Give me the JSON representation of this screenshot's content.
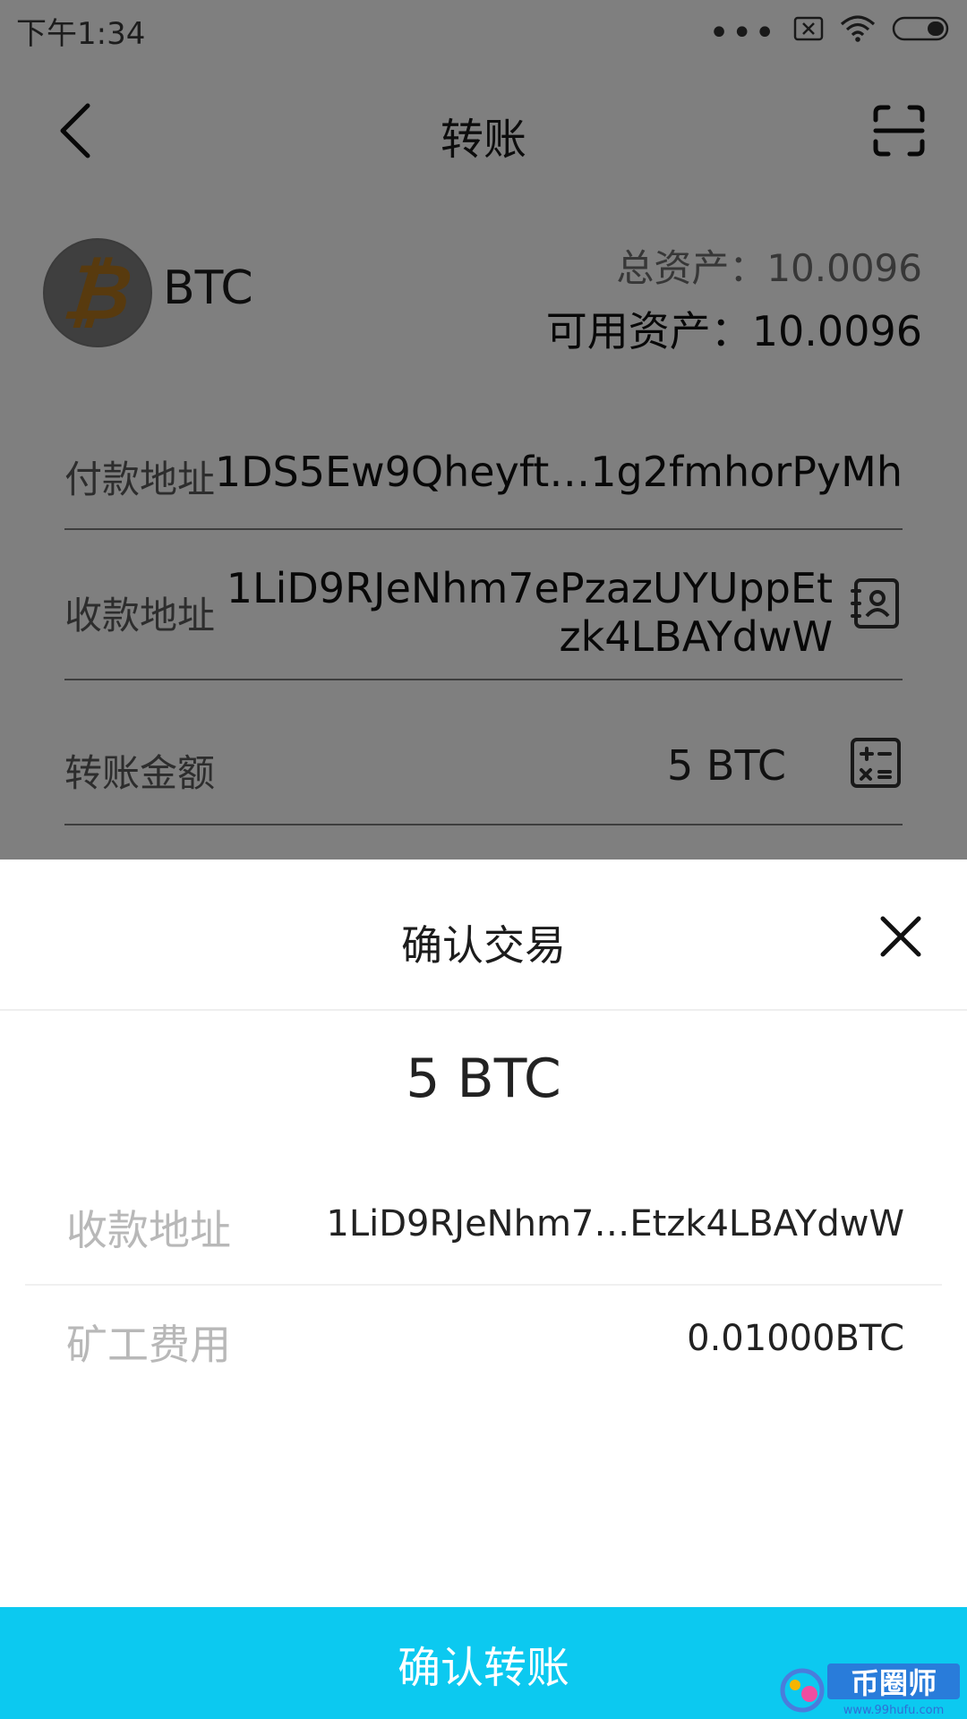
{
  "status_bar": {
    "time": "下午1:34",
    "icons": [
      "signal-dots-icon",
      "no-sim-icon",
      "wifi-icon",
      "battery-icon"
    ]
  },
  "header": {
    "title": "转账",
    "back_icon": "back-arrow-icon",
    "scan_icon": "scan-icon"
  },
  "asset": {
    "coin_icon": "bitcoin-icon",
    "coin_symbol": "₿",
    "coin_name": "BTC",
    "total_label": "总资产",
    "total_value": "10.0096",
    "total_text": "总资产：10.0096",
    "available_text": "可用资产：10.0096"
  },
  "form": {
    "pay_address_label": "付款地址",
    "pay_address_value": "1DS5Ew9Qheyft…1g2fmhorPyMh",
    "recv_address_label": "收款地址",
    "recv_address_line1": "1LiD9RJeNhm7ePzazUYUppEt",
    "recv_address_line2": "zk4LBAYdwW",
    "amount_label": "转账金额",
    "amount_value": "5 BTC",
    "contacts_icon": "address-book-icon",
    "calculator_icon": "calculator-icon"
  },
  "sheet": {
    "title": "确认交易",
    "close_icon": "close-icon",
    "amount": "5 BTC",
    "recv_label": "收款地址",
    "recv_value": "1LiD9RJeNhm7…Etzk4LBAYdwW",
    "fee_label": "矿工费用",
    "fee_value": "0.01000BTC",
    "confirm_label": "确认转账"
  },
  "watermark": {
    "text": "币圈师",
    "url": "www.99hufu.com"
  },
  "colors": {
    "accent": "#0cc9f0",
    "bitcoin": "#f7931a",
    "overlay": "rgba(0,0,0,0.5)"
  }
}
